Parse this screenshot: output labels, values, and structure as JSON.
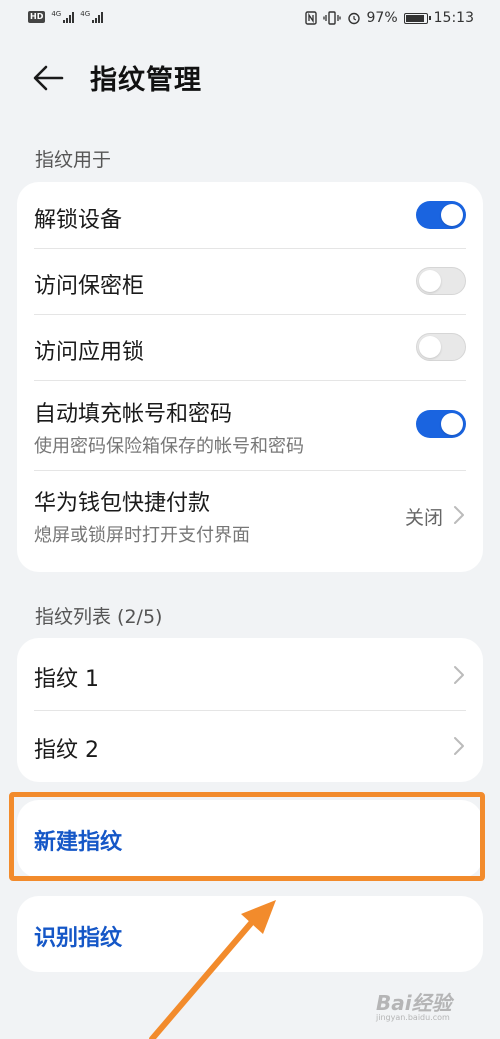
{
  "status_bar": {
    "hd_badge": "HD",
    "sim1_net": "4G",
    "sim2_net": "4G",
    "battery_percent": "97%",
    "battery_level": 0.97,
    "time": "15:13"
  },
  "header": {
    "back_icon": "back-arrow-icon",
    "title": "指纹管理"
  },
  "usage_section": {
    "label": "指纹用于",
    "rows": [
      {
        "title": "解锁设备",
        "toggle": true
      },
      {
        "title": "访问保密柜",
        "toggle": false
      },
      {
        "title": "访问应用锁",
        "toggle": false
      },
      {
        "title": "自动填充帐号和密码",
        "subtitle": "使用密码保险箱保存的帐号和密码",
        "toggle": true
      },
      {
        "title": "华为钱包快捷付款",
        "subtitle": "熄屏或锁屏时打开支付界面",
        "value": "关闭"
      }
    ]
  },
  "fingerprint_list": {
    "label": "指纹列表 (2/5)",
    "items": [
      {
        "title": "指纹 1"
      },
      {
        "title": "指纹 2"
      }
    ]
  },
  "actions": {
    "new_fingerprint": "新建指纹",
    "identify_fingerprint": "识别指纹"
  },
  "annotation": {
    "highlight_color": "#f28b2c"
  },
  "colors": {
    "accent": "#1a64e0",
    "action_text": "#1557c7",
    "background": "#f1f3f5"
  },
  "watermark": {
    "logo": "Bai经验",
    "url": "jingyan.baidu.com"
  }
}
